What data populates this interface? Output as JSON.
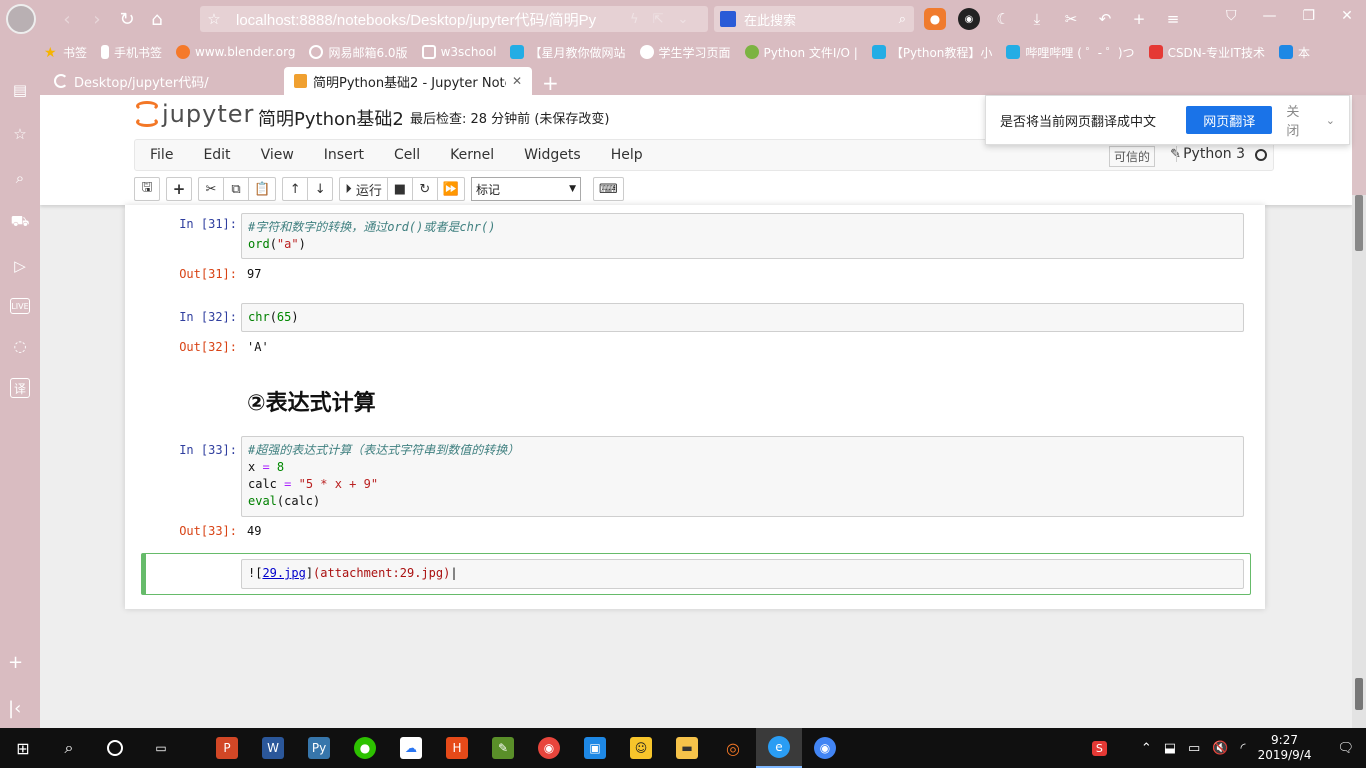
{
  "browser": {
    "url": "localhost:8888/notebooks/Desktop/jupyter代码/简明Py",
    "search_placeholder": "在此搜索",
    "bookmarks": [
      "书签",
      "手机书签",
      "www.blender.org",
      "网易邮箱6.0版",
      "w3school",
      "【星月教你做网站",
      "学生学习页面",
      "Python 文件I/O |",
      "【Python教程】小",
      "哔哩哔哩 ( ゜- ゜)つ",
      "CSDN-专业IT技术",
      "本"
    ],
    "tabs": [
      {
        "label": "Desktop/jupyter代码/"
      },
      {
        "label": "简明Python基础2 - Jupyter Noteb"
      }
    ]
  },
  "jupyter": {
    "logo_text": "jupyter",
    "notebook_name": "简明Python基础2",
    "checkpoint": "最后检查: 28 分钟前  (未保存改变)",
    "menu": [
      "File",
      "Edit",
      "View",
      "Insert",
      "Cell",
      "Kernel",
      "Widgets",
      "Help"
    ],
    "trusted": "可信的",
    "kernel": "Python 3",
    "run_label": "运行",
    "cell_type": "标记"
  },
  "translate": {
    "question": "是否将当前网页翻译成中文",
    "button": "网页翻译",
    "close": "关闭"
  },
  "cells": {
    "c31_in": "In  [31]:",
    "c31_line1": "#字符和数字的转换，通过ord()或者是chr()",
    "c31_out_prompt": "Out[31]:",
    "c31_out": "97",
    "c32_in": "In  [32]:",
    "c32_out_prompt": "Out[32]:",
    "c32_out": "'A'",
    "heading": "②表达式计算",
    "c33_in": "In  [33]:",
    "c33_line1": "#超强的表达式计算（表达式字符串到数值的转换）",
    "c33_out_prompt": "Out[33]:",
    "c33_out": "49",
    "edit_link": "29.jpg",
    "edit_rest": "(attachment:29.jpg)"
  },
  "taskbar": {
    "time": "9:27",
    "date": "2019/9/4"
  }
}
